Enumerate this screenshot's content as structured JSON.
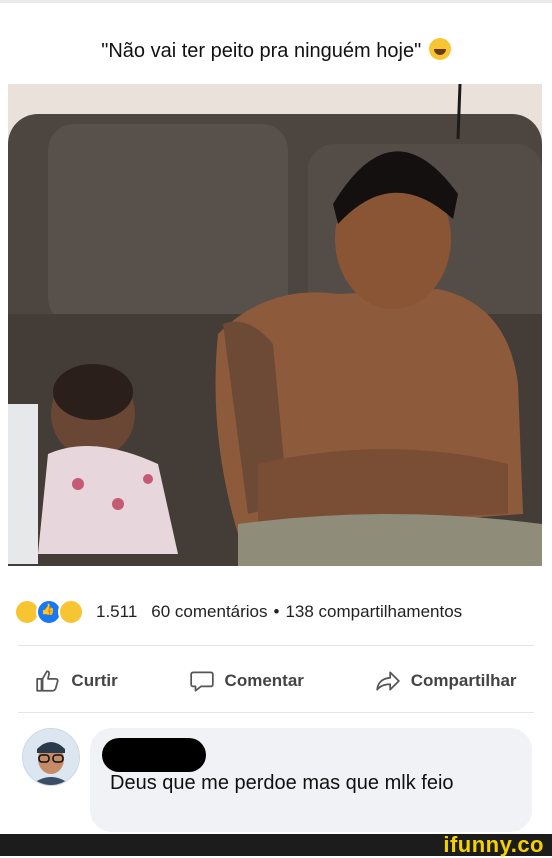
{
  "post": {
    "caption": "\"Não vai ter peito pra ninguém hoje\"",
    "caption_emoji": "grinning-sweat-icon"
  },
  "stats": {
    "reaction_count": "1.511",
    "comments": "60 comentários",
    "separator": "•",
    "shares": "138 compartilhamentos"
  },
  "actions": {
    "like": "Curtir",
    "comment": "Comentar",
    "share": "Compartilhar"
  },
  "comment": {
    "text": "Deus que me perdoe mas que mlk feio"
  },
  "footer": {
    "watermark": "ifunny.co"
  },
  "colors": {
    "accent": "#1877f2",
    "bubble": "#f0f2f5",
    "watermark": "#f5d100"
  }
}
